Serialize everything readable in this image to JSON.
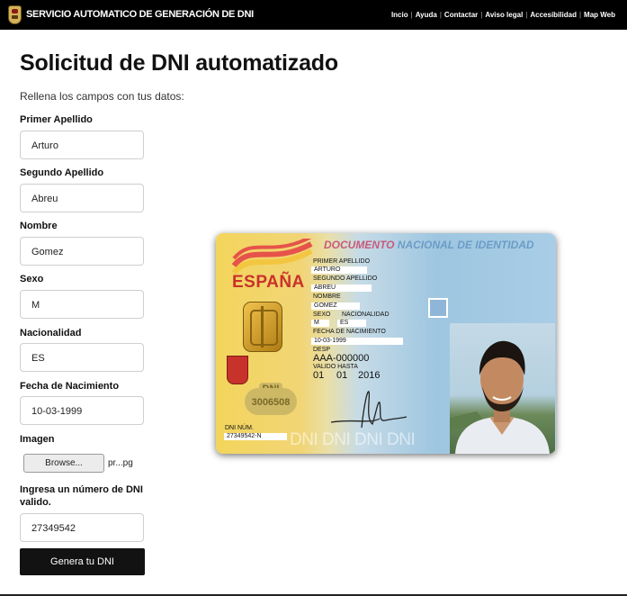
{
  "header": {
    "title": "SERVICIO AUTOMATICO DE GENERACIÓN DE DNI",
    "nav": [
      "Incio",
      "Ayuda",
      "Contactar",
      "Aviso legal",
      "Accesibilidad",
      "Map Web"
    ]
  },
  "page": {
    "heading": "Solicitud de DNI automatizado",
    "intro": "Rellena los campos con tus datos:"
  },
  "form": {
    "primer_apellido_label": "Primer Apellido",
    "primer_apellido_value": "Arturo",
    "segundo_apellido_label": "Segundo Apellido",
    "segundo_apellido_value": "Abreu",
    "nombre_label": "Nombre",
    "nombre_value": "Gomez",
    "sexo_label": "Sexo",
    "sexo_value": "M",
    "nacionalidad_label": "Nacionalidad",
    "nacionalidad_value": "ES",
    "fecha_label": "Fecha de Nacimiento",
    "fecha_value": "10-03-1999",
    "imagen_label": "Imagen",
    "browse_label": "Browse...",
    "file_name": "pr...pg",
    "dni_label_line1": "Ingresa un número de DNI",
    "dni_label_line2": "valido.",
    "dni_value": "27349542",
    "submit_label": "Genera tu DNI"
  },
  "card": {
    "header_a": "DOCUMENTO",
    "header_b": "NACIONAL DE IDENTIDAD",
    "country": "ESPAÑA",
    "seal_top": "DNI",
    "seal_number": "3006508",
    "primer_apellido_label": "PRIMER APELLIDO",
    "primer_apellido_value": "ARTURO",
    "segundo_apellido_label": "SEGUNDO APELLIDO",
    "segundo_apellido_value": "ABREU",
    "nombre_label": "NOMBRE",
    "nombre_value": "GOMEZ",
    "sexo_label": "SEXO",
    "sexo_value": "M",
    "nacionalidad_label": "NACIONALIDAD",
    "nacionalidad_value": "ES",
    "fecha_label": "FECHA DE NACIMIENTO",
    "fecha_value": "10-03-1999",
    "desp_label": "DESP",
    "desp_value": "AAA-000000",
    "valido_label": "VALIDO HASTA",
    "valido_day": "01",
    "valido_month": "01",
    "valido_year": "2016",
    "dni_num_label": "DNI NÚM.",
    "dni_num_value": "27349542-N",
    "watermark": "DNI DNI DNI DNI"
  }
}
